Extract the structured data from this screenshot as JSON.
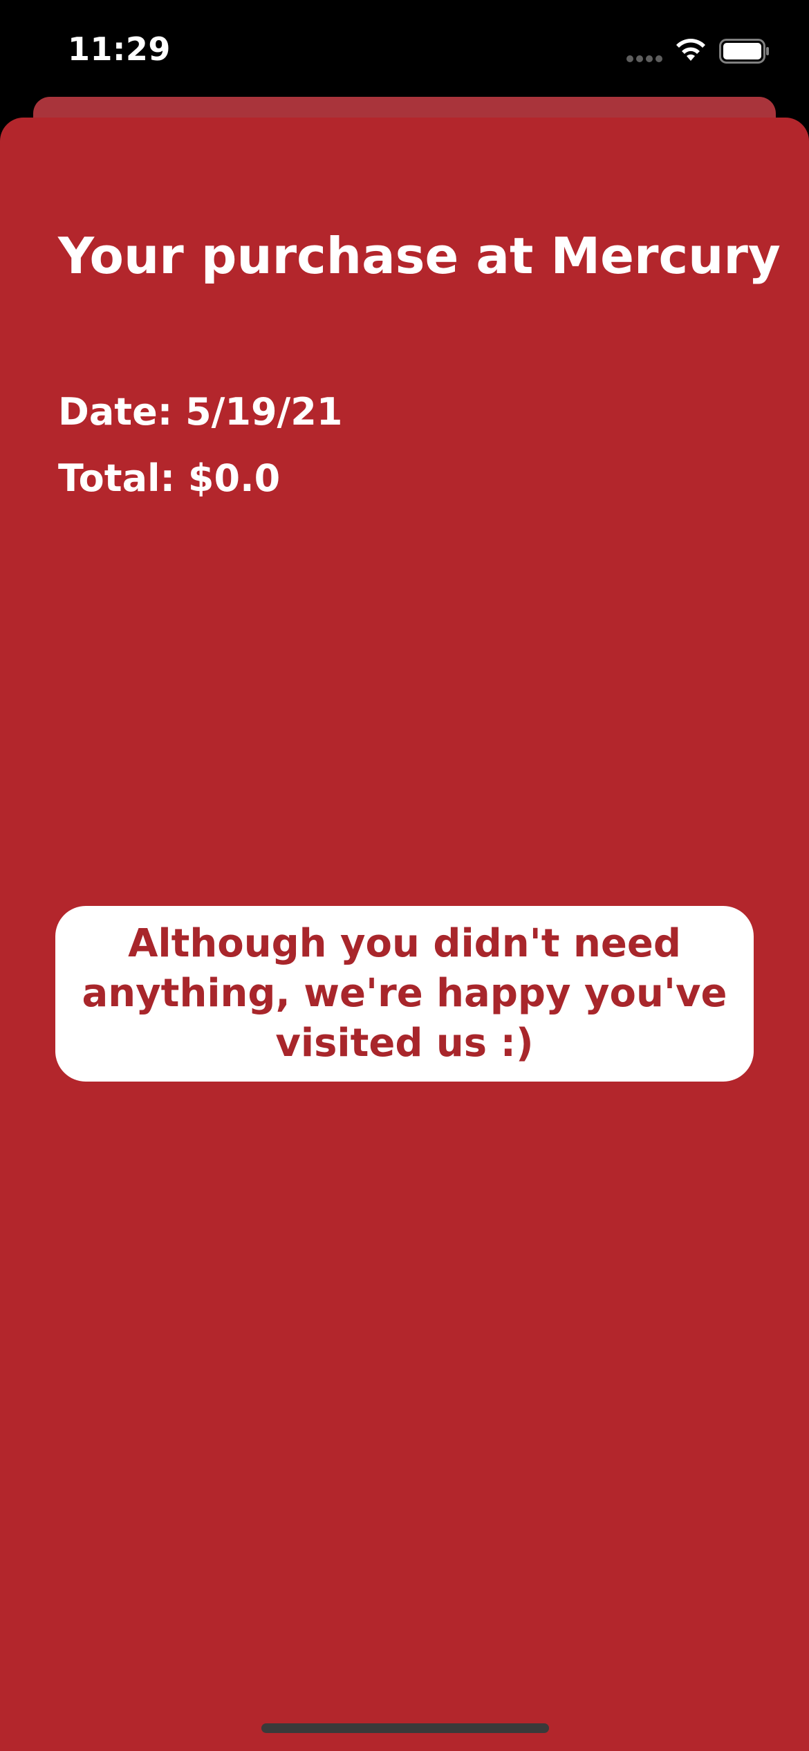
{
  "status_bar": {
    "time": "11:29",
    "icons": [
      "signal-dots-icon",
      "wifi-icon",
      "battery-icon"
    ]
  },
  "receipt": {
    "title": "Your purchase at Mercury",
    "date": "Date: 5/19/21",
    "total": "Total: $0.0",
    "message": "Although you didn't need anything, we're happy you've visited us :)"
  },
  "colors": {
    "sheet_background": "#b3262c",
    "back_sheet": "#a9343b",
    "message_card_background": "#ffffff",
    "message_text": "#a8262b",
    "status_bar_background": "#000000"
  }
}
